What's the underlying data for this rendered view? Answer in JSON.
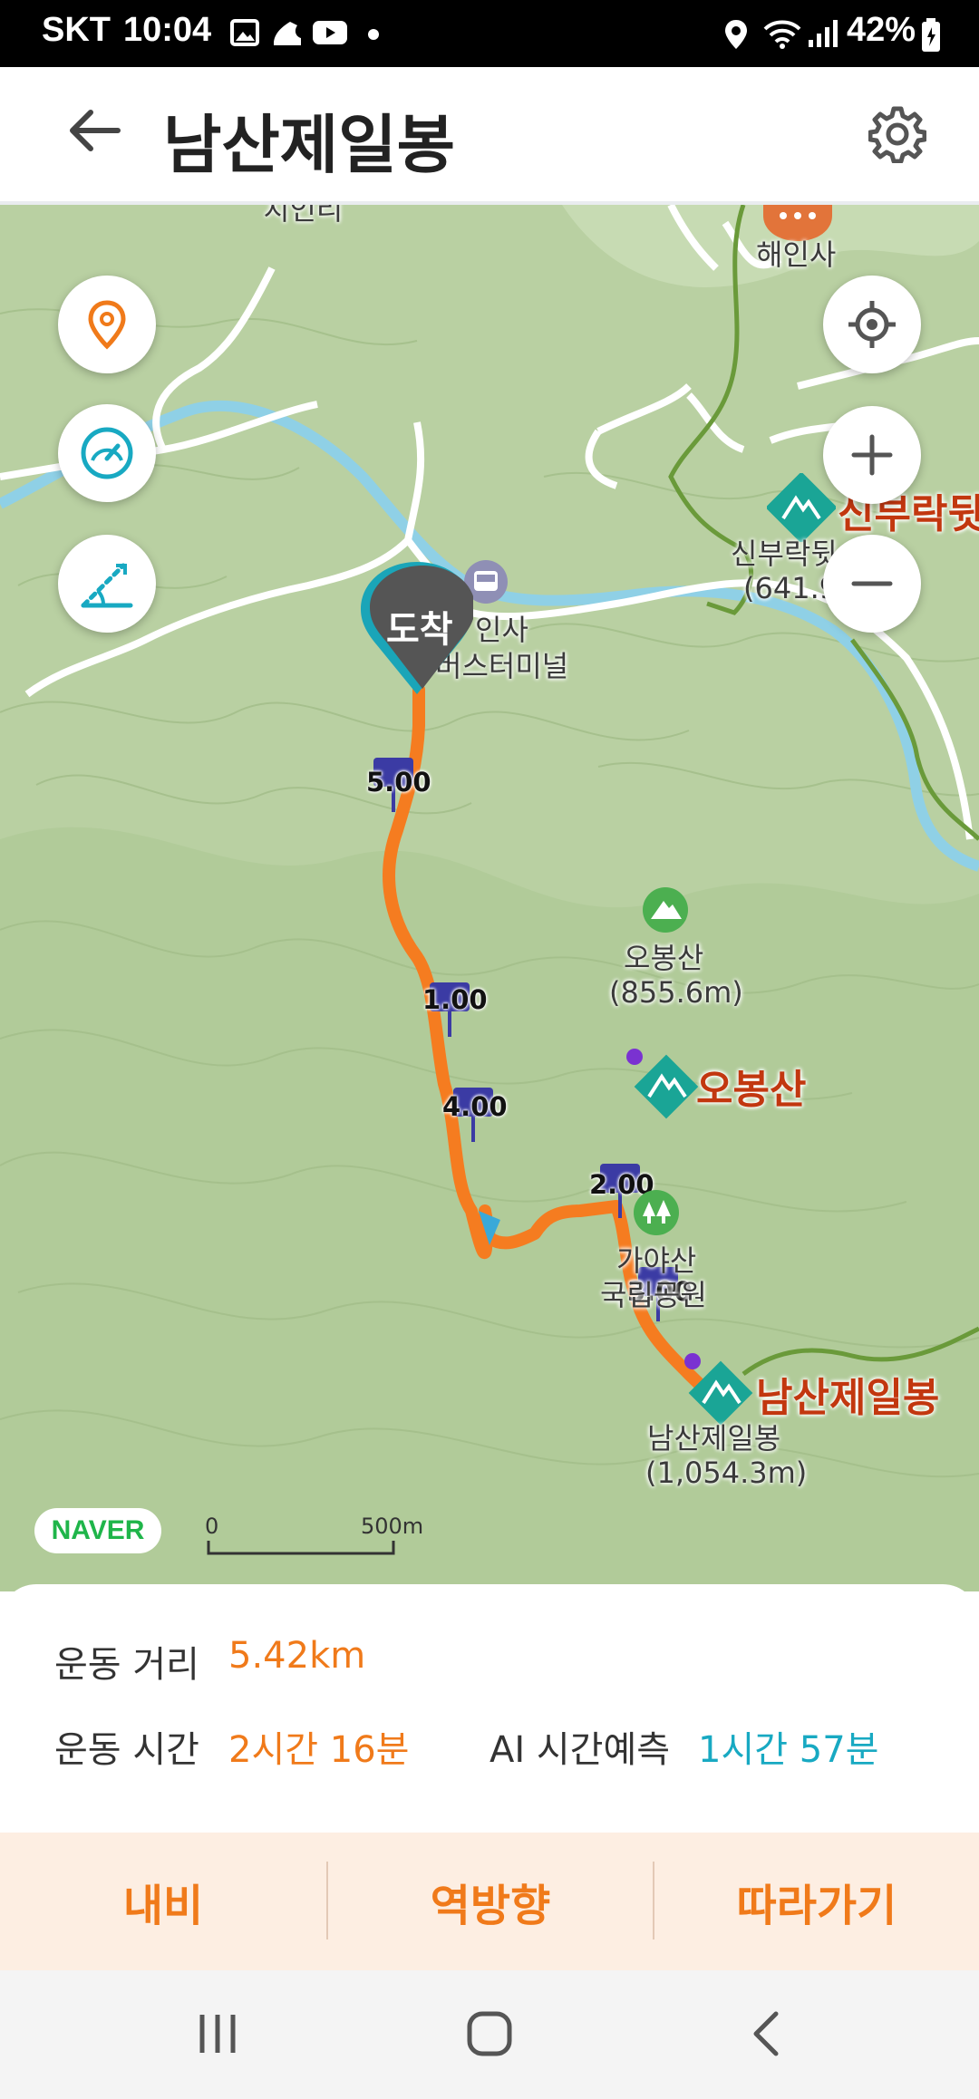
{
  "status_bar": {
    "carrier": "SKT",
    "time": "10:04",
    "battery": "42%"
  },
  "header": {
    "title": "남산제일봉",
    "back_icon": "back-arrow-icon",
    "settings_icon": "gear-icon"
  },
  "map": {
    "labels": {
      "haeinsa": "해인사",
      "sinbu_peak": "신부락뒷",
      "sinbu_label": "신부락뒷",
      "sinbu_elev": "(641.9",
      "bus_terminal_1": "인사",
      "bus_terminal_2": "버스터미널",
      "obong_label": "오봉산",
      "obong_elev": "(855.6m)",
      "obong_peak": "오봉산",
      "gaya_1": "가야산",
      "gaya_2": "국립공원",
      "namsan_peak": "남산제일봉",
      "namsan_label": "남산제일봉",
      "namsan_elev": "(1,054.3m)",
      "top_partial": "치인리"
    },
    "arrival_pin": "도착",
    "km_markers": [
      "5.00",
      "1.00",
      "4.00",
      "2.00",
      "3.00"
    ],
    "scale": {
      "zero": "0",
      "distance": "500m"
    },
    "logo": "NAVER"
  },
  "stats": {
    "distance_label": "운동 거리",
    "distance_value": "5.42km",
    "time_label": "운동 시간",
    "time_value": "2시간 16분",
    "ai_label": "AI 시간예측",
    "ai_value": "1시간 57분"
  },
  "actions": {
    "navi": "내비",
    "reverse": "역방향",
    "follow": "따라가기"
  },
  "colors": {
    "route": "#f57c20",
    "accent": "#f07a1a",
    "teal": "#18a9c2",
    "map_bg": "#b7cfa1"
  }
}
